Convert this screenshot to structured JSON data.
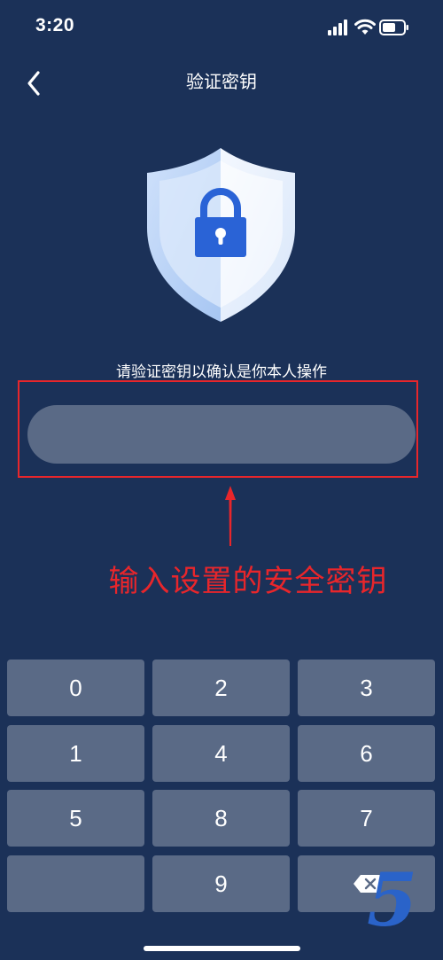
{
  "status_bar": {
    "time": "3:20"
  },
  "nav": {
    "title": "验证密钥",
    "back_icon": "chevron-left-icon"
  },
  "shield": {
    "icon": "shield-lock-icon"
  },
  "instruction": "请验证密钥以确认是你本人操作",
  "key_input": {
    "value": "",
    "placeholder": ""
  },
  "annotation": {
    "text": "输入设置的安全密钥",
    "color": "#e8262b"
  },
  "keypad": {
    "keys": [
      "0",
      "2",
      "3",
      "1",
      "4",
      "6",
      "5",
      "8",
      "7",
      "",
      "9"
    ],
    "delete_icon": "backspace-icon"
  },
  "watermark": "5",
  "colors": {
    "background": "#1b3158",
    "key_background": "#5a6a86",
    "annotation_red": "#e8262b",
    "accent_blue": "#2a63c9"
  }
}
